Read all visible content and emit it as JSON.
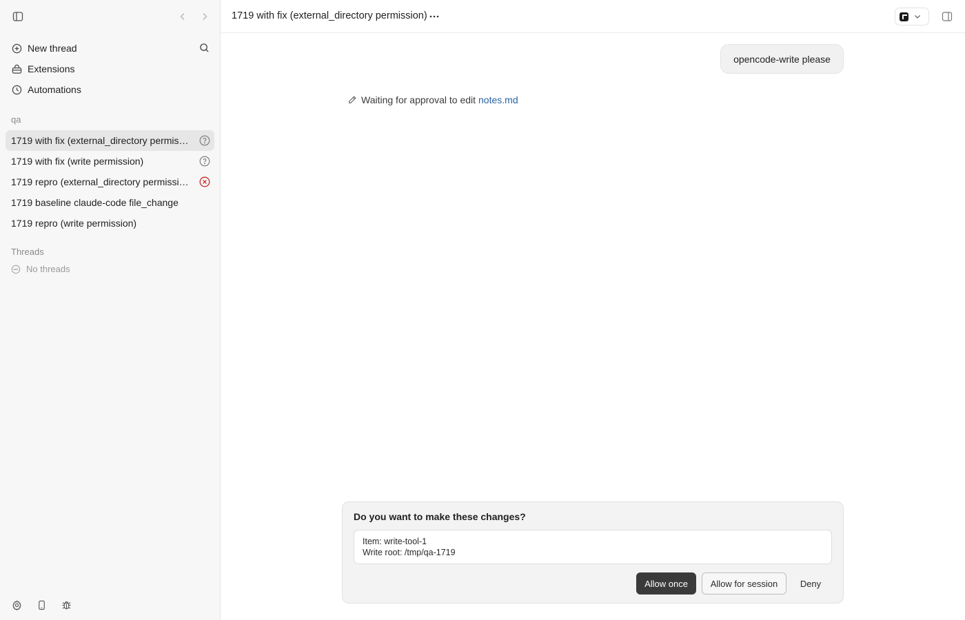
{
  "sidebar": {
    "nav": [
      {
        "label": "New thread",
        "icon": "plus-circle-icon"
      },
      {
        "label": "Extensions",
        "icon": "extensions-icon"
      },
      {
        "label": "Automations",
        "icon": "clock-icon"
      }
    ],
    "project_label": "qa",
    "project_threads": [
      {
        "label": "1719 with fix (external_directory permission)",
        "status": "question"
      },
      {
        "label": "1719 with fix (write permission)",
        "status": "question"
      },
      {
        "label": "1719 repro (external_directory permission)",
        "status": "error"
      },
      {
        "label": "1719 baseline claude-code file_change",
        "status": ""
      },
      {
        "label": "1719 repro (write permission)",
        "status": ""
      }
    ],
    "threads_label": "Threads",
    "empty_label": "No threads"
  },
  "header": {
    "title": "1719 with fix (external_directory permission)"
  },
  "conversation": {
    "user_message": "opencode-write please",
    "status_text": "Waiting for approval to edit",
    "status_file": "notes.md"
  },
  "approval": {
    "question": "Do you want to make these changes?",
    "detail_item": "Item: write-tool-1",
    "detail_root": "Write root: /tmp/qa-1719",
    "allow_once": "Allow once",
    "allow_session": "Allow for session",
    "deny": "Deny"
  },
  "colors": {
    "sidebar_bg": "#f7f7f7",
    "active_row": "#e6e6e6",
    "link": "#2a62a3",
    "error": "#c62828",
    "primary_button": "#3a3a3a"
  }
}
